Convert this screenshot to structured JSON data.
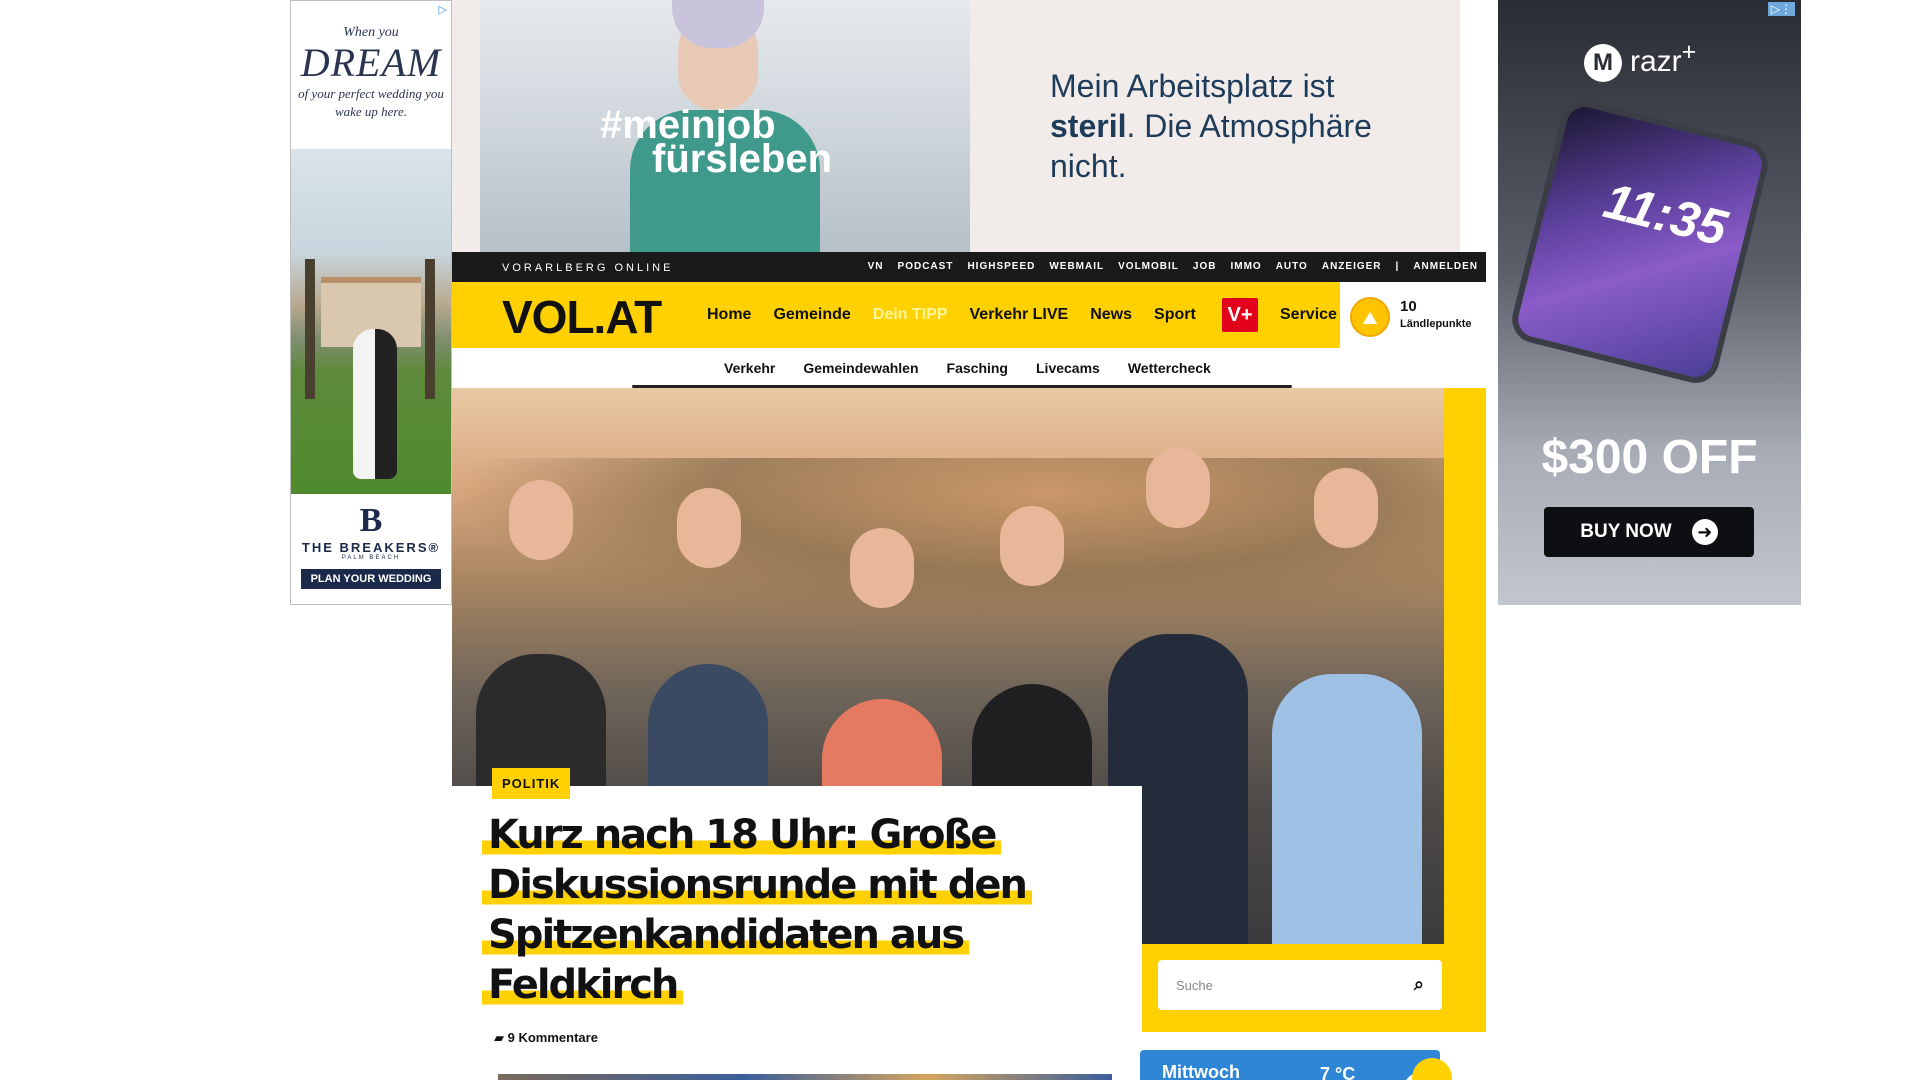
{
  "ad_left": {
    "adchoice_icon": "adchoices-icon",
    "line1": "When you",
    "line2": "DREAM",
    "line3": "of your perfect wedding you wake up here.",
    "logo": "B",
    "brand": "THE BREAKERS®",
    "brand_sub": "PALM BEACH",
    "cta": "PLAN YOUR WEDDING"
  },
  "ad_top": {
    "hashtag_line1": "#meinjob",
    "hashtag_line2": "fürsleben",
    "text_a": "Mein Arbeitsplatz ist",
    "text_bold": "steril",
    "text_b": ". Die Atmosphäre nicht."
  },
  "ad_right": {
    "brand": "razr",
    "brand_sup": "+",
    "phone_time": "11:35",
    "offer": "$300 OFF",
    "cta": "BUY NOW"
  },
  "topbar": {
    "site_name": "VORARLBERG ONLINE",
    "links": [
      "VN",
      "PODCAST",
      "HIGHSPEED",
      "WEBMAIL",
      "VOLMOBIL",
      "JOB",
      "IMMO",
      "AUTO",
      "ANZEIGER",
      "|",
      "ANMELDEN"
    ]
  },
  "mainnav": {
    "logo": "VOL.AT",
    "items": [
      "Home",
      "Gemeinde",
      "Dein TIPP",
      "Verkehr LIVE",
      "News",
      "Sport"
    ],
    "vplus": "V+",
    "service": "Service",
    "points_value": "10",
    "points_label": "Ländlepunkte"
  },
  "subnav": {
    "items": [
      "Verkehr",
      "Gemeindewahlen",
      "Fasching",
      "Livecams",
      "Wettercheck"
    ]
  },
  "hero": {
    "category": "POLITIK",
    "headline_lines": [
      "Kurz nach 18 Uhr: Große",
      "Diskussionsrunde mit den",
      "Spitzenkandidaten aus",
      "Feldkirch"
    ],
    "comments": "9 Kommentare",
    "search_placeholder": "Suche"
  },
  "weather": {
    "day": "Mittwoch",
    "temp": "7 °C"
  },
  "colors": {
    "brand_yellow": "#ffd100",
    "topbar_black": "#1a1a1a",
    "vplus_red": "#e2001a",
    "weather_blue": "#2f86d6"
  }
}
